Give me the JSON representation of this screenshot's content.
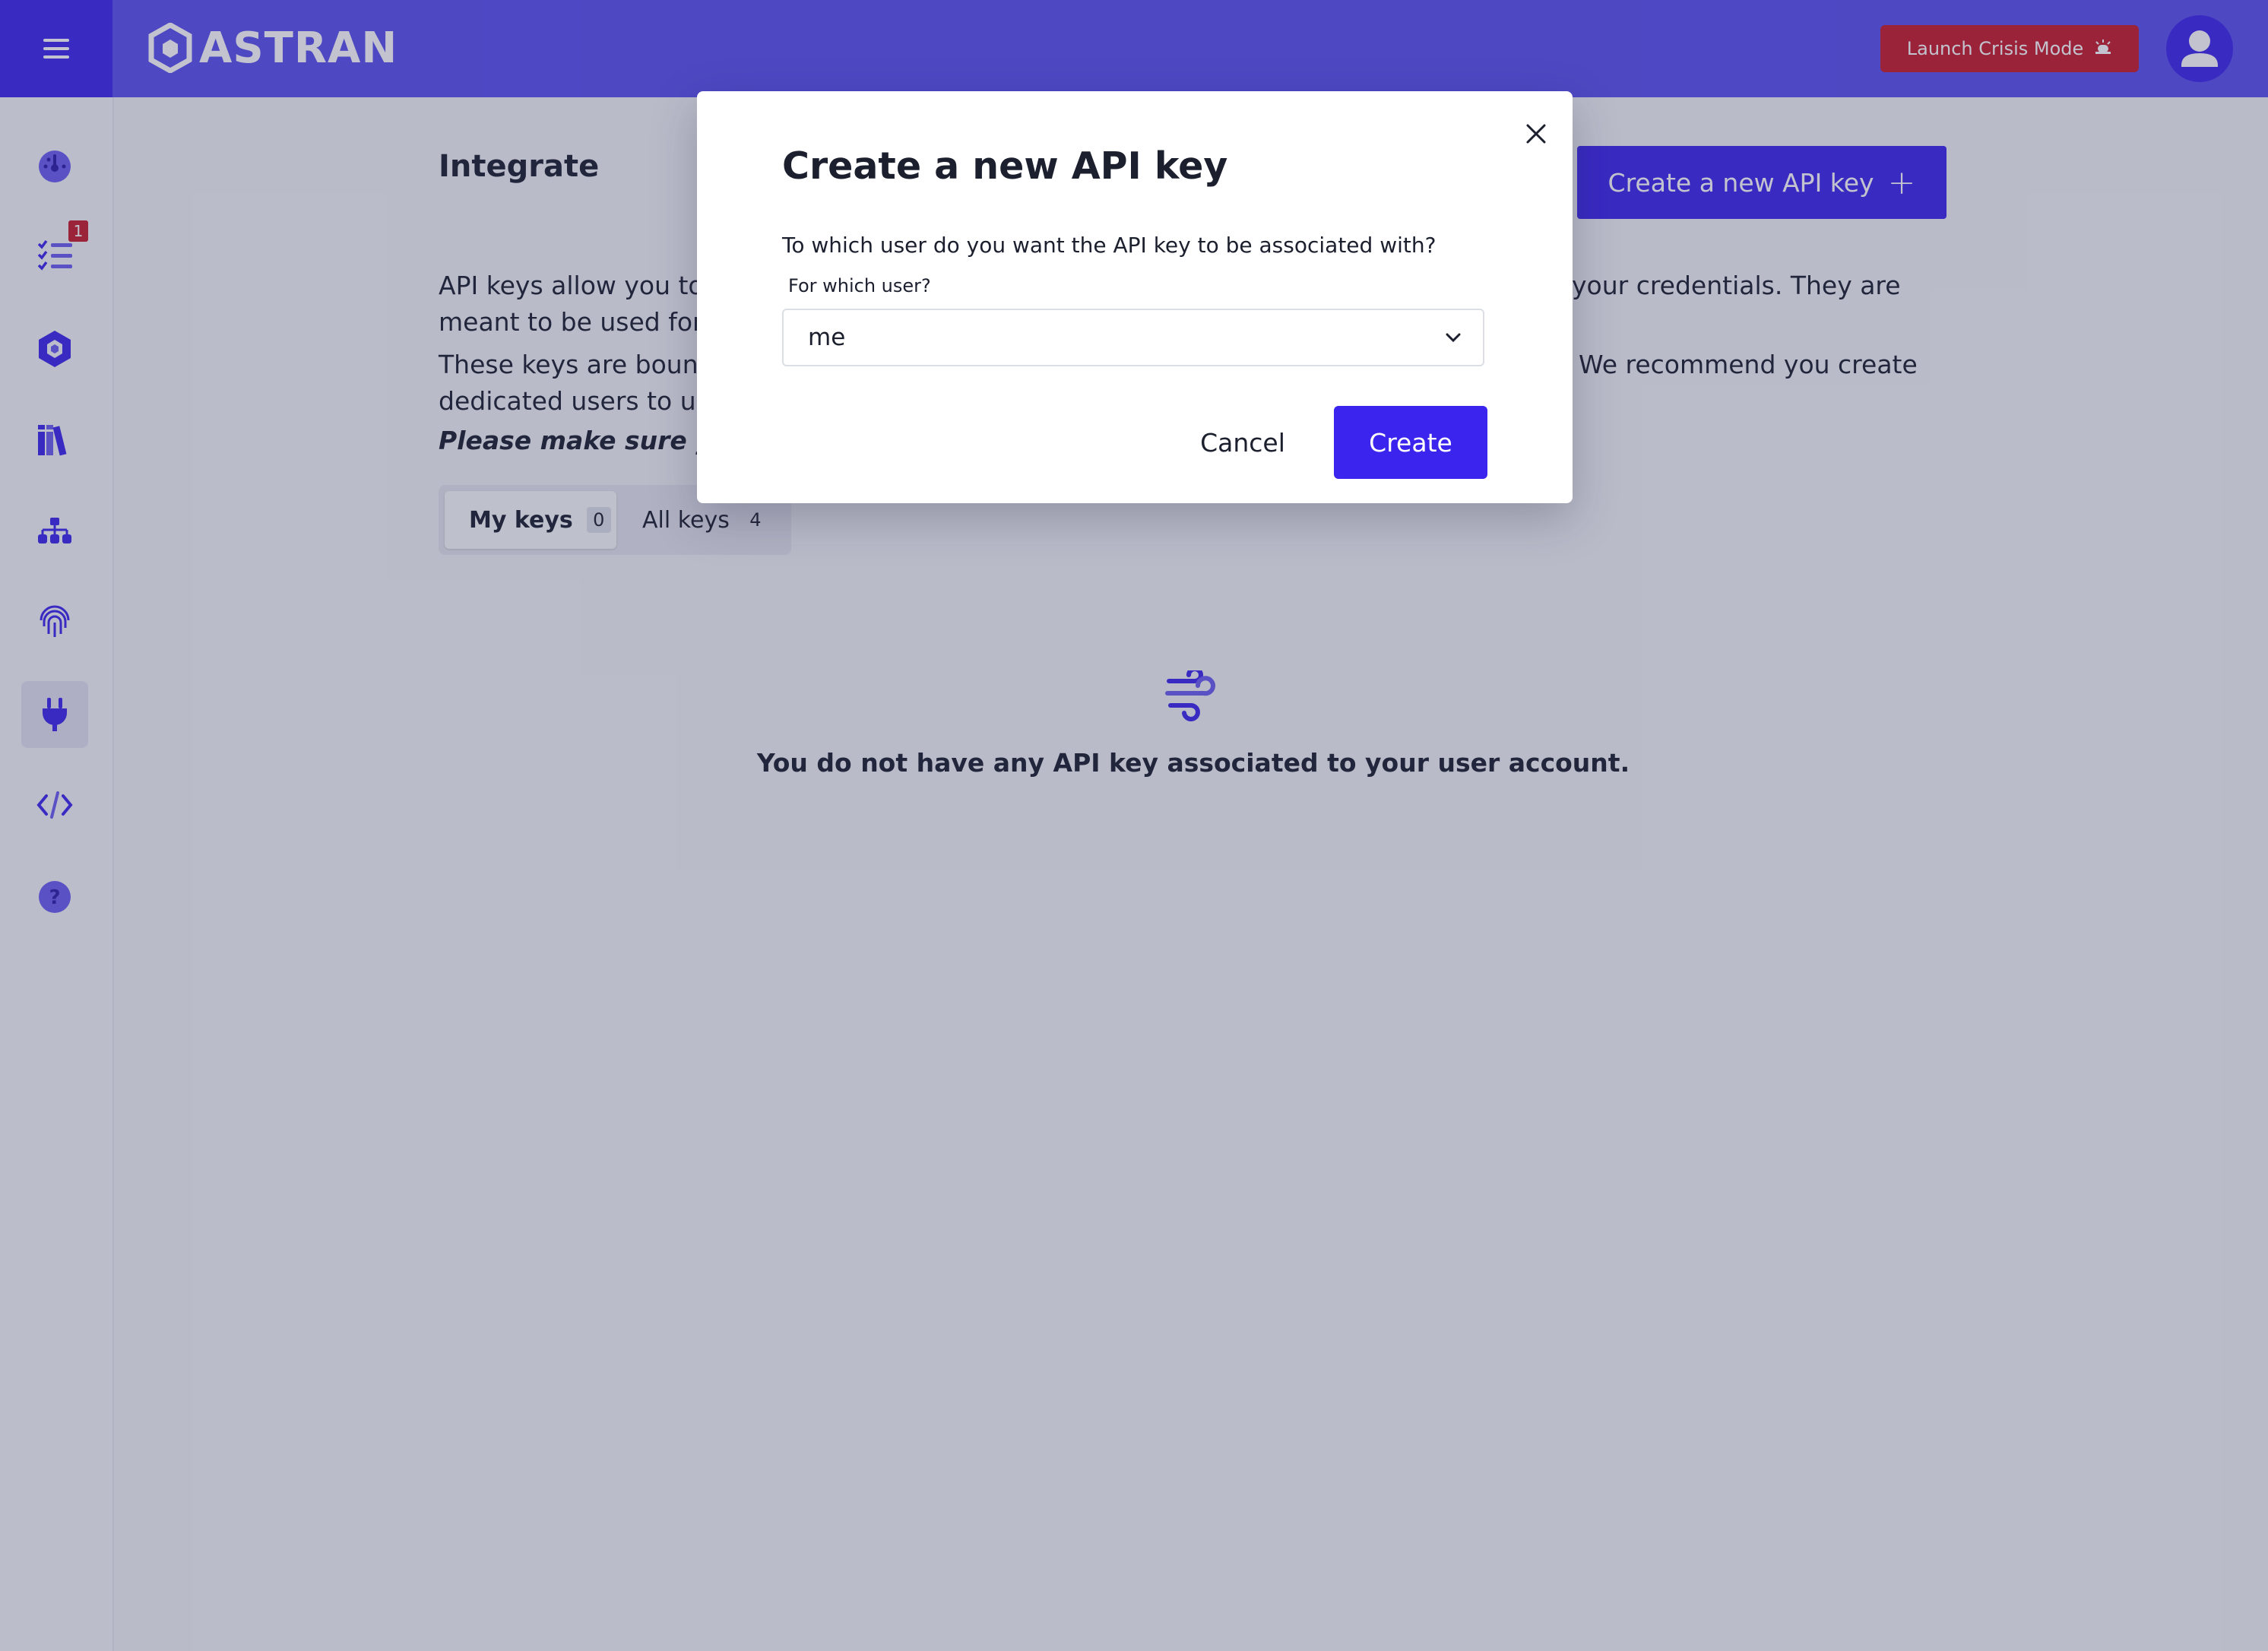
{
  "header": {
    "brand": "ASTRAN",
    "crisis_label": "Launch Crisis Mode",
    "crisis_icon": "siren-icon"
  },
  "sidebar": {
    "items": [
      {
        "name": "dashboard",
        "icon": "gauge-icon"
      },
      {
        "name": "tasks",
        "icon": "checklist-icon",
        "badge": "1"
      },
      {
        "name": "supply-chain",
        "icon": "cube-network-icon"
      },
      {
        "name": "library",
        "icon": "books-icon"
      },
      {
        "name": "organization",
        "icon": "org-chart-icon"
      },
      {
        "name": "identity",
        "icon": "fingerprint-icon"
      },
      {
        "name": "integrate",
        "icon": "plug-icon",
        "active": true
      },
      {
        "name": "developer",
        "icon": "code-icon"
      },
      {
        "name": "help",
        "icon": "question-icon"
      }
    ]
  },
  "main": {
    "title": "Integrate",
    "new_key_label": "Create a new API key",
    "para1": "API keys allow you to use the platform programmatically without providing your credentials. They are meant to be used for",
    "para1_tail": "your credentials. They are",
    "para1_line2": "meant to be used for",
    "para2_line1": "These keys are bound",
    "para2_tail": "We recommend you create",
    "para2_line2": "dedicated users to us",
    "warning": "Please make sure yo",
    "tabs": [
      {
        "label": "My keys",
        "count": "0",
        "active": true
      },
      {
        "label": "All keys",
        "count": "4",
        "active": false
      }
    ],
    "empty_message": "You do not have any API key associated to your user account."
  },
  "modal": {
    "title": "Create a new API key",
    "question": "To which user do you want the API key to be associated with?",
    "field_label": "For which user?",
    "selected_user": "me",
    "cancel_label": "Cancel",
    "create_label": "Create"
  },
  "colors": {
    "primary": "#3b24ee",
    "header": "#5a4ff0",
    "crisis": "#c81a2a"
  }
}
